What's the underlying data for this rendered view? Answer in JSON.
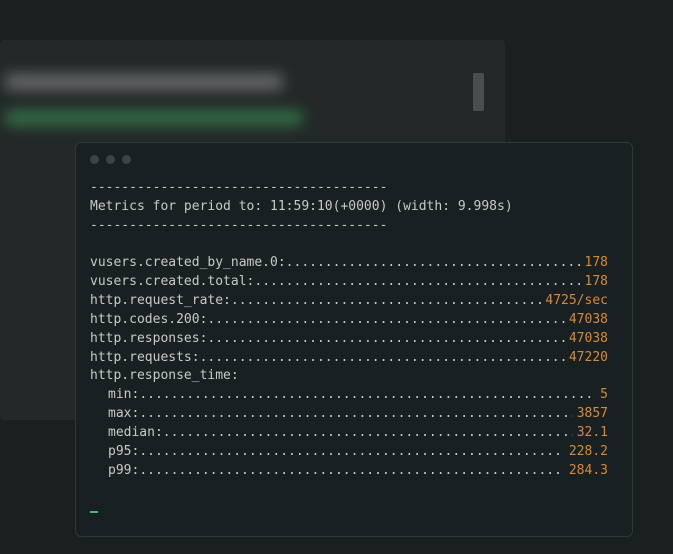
{
  "header": {
    "dashes": "--------------------------------------",
    "title": "Metrics for period to: 11:59:10(+0000) (width: 9.998s)"
  },
  "metrics": [
    {
      "label": "vusers.created_by_name.0:",
      "value": "178",
      "indent": false
    },
    {
      "label": "vusers.created.total:",
      "value": "178",
      "indent": false
    },
    {
      "label": "http.request_rate:",
      "value": "4725/sec",
      "indent": false
    },
    {
      "label": "http.codes.200:",
      "value": "47038",
      "indent": false
    },
    {
      "label": "http.responses:",
      "value": "47038",
      "indent": false
    },
    {
      "label": "http.requests:",
      "value": "47220",
      "indent": false
    }
  ],
  "response_time": {
    "label": "http.response_time:",
    "items": [
      {
        "label": "min:",
        "value": "5"
      },
      {
        "label": "max:",
        "value": "3857"
      },
      {
        "label": "median:",
        "value": "32.1"
      },
      {
        "label": "p95:",
        "value": "228.2"
      },
      {
        "label": "p99:",
        "value": "284.3"
      }
    ]
  }
}
